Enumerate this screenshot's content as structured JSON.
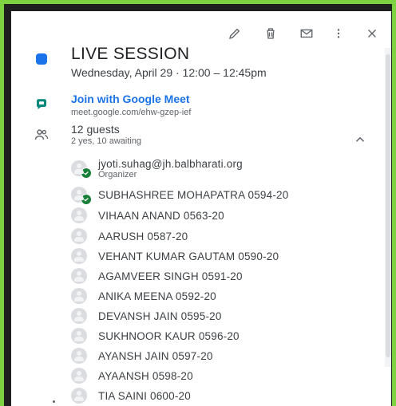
{
  "event": {
    "title": "LIVE SESSION",
    "date_time": "Wednesday, April 29  ·  12:00 – 12:45pm",
    "color": "#1a73e8"
  },
  "toolbar": {
    "edit_icon": "pencil-icon",
    "delete_icon": "trash-icon",
    "email_icon": "mail-icon",
    "more_icon": "more-vert-icon",
    "close_icon": "close-icon"
  },
  "meet": {
    "label": "Join with Google Meet",
    "url": "meet.google.com/ehw-gzep-ief",
    "icon": "google-meet-icon"
  },
  "guests": {
    "count_label": "12 guests",
    "summary": "2 yes, 10 awaiting",
    "list": [
      {
        "name": "jyoti.suhag@jh.balbharati.org",
        "role": "Organizer",
        "accepted": true
      },
      {
        "name": "SUBHASHREE MOHAPATRA 0594-20",
        "accepted": true
      },
      {
        "name": "VIHAAN ANAND 0563-20",
        "accepted": false
      },
      {
        "name": "AARUSH 0587-20",
        "accepted": false
      },
      {
        "name": "VEHANT KUMAR GAUTAM 0590-20",
        "accepted": false
      },
      {
        "name": "AGAMVEER SINGH 0591-20",
        "accepted": false
      },
      {
        "name": "ANIKA MEENA 0592-20",
        "accepted": false
      },
      {
        "name": "DEVANSH JAIN 0595-20",
        "accepted": false
      },
      {
        "name": "SUKHNOOR KAUR 0596-20",
        "accepted": false
      },
      {
        "name": "AYANSH JAIN 0597-20",
        "accepted": false
      },
      {
        "name": "AYAANSH 0598-20",
        "accepted": false
      },
      {
        "name": "TIA SAINI 0600-20",
        "accepted": false
      }
    ]
  },
  "colors": {
    "frame_green": "#7ed13f",
    "meet_teal": "#00897b",
    "accepted_green": "#188038"
  }
}
